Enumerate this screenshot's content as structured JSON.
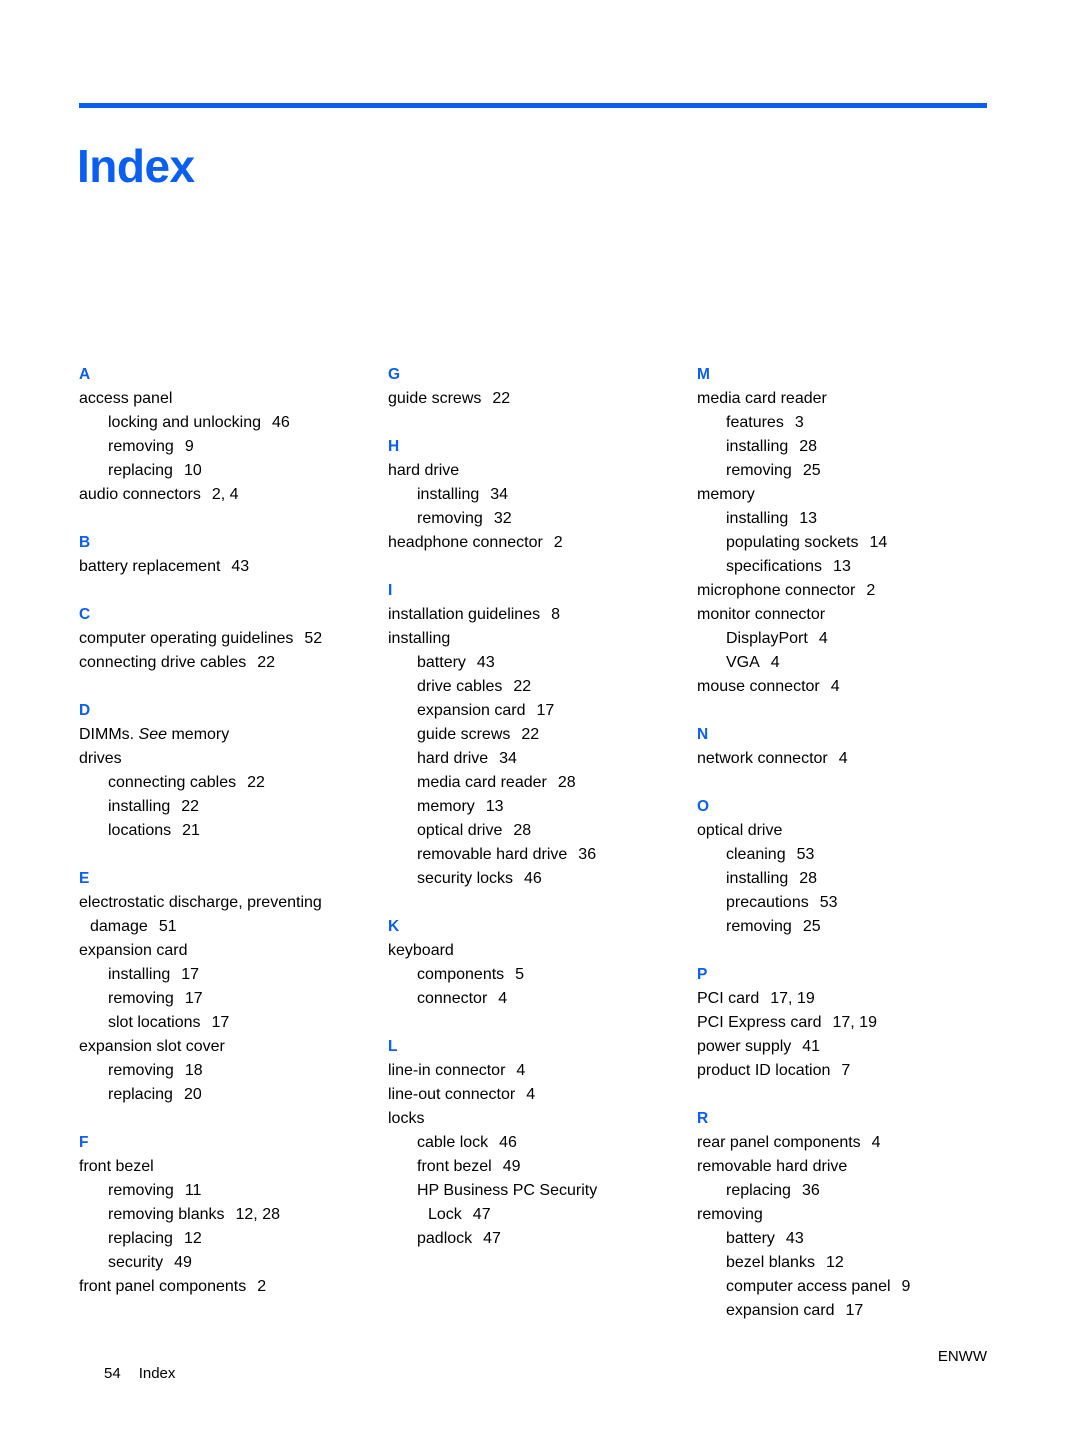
{
  "document": {
    "title": "Index",
    "accent_color": "#0a5ff0"
  },
  "footer": {
    "page_number": "54",
    "section_label": "Index",
    "right_label": "ENWW"
  },
  "columns": [
    {
      "groups": [
        {
          "letter": "A",
          "entries": [
            {
              "level": 1,
              "text": "access panel",
              "pages": ""
            },
            {
              "level": 2,
              "text": "locking and unlocking",
              "pages": "46"
            },
            {
              "level": 2,
              "text": "removing",
              "pages": "9"
            },
            {
              "level": 2,
              "text": "replacing",
              "pages": "10"
            },
            {
              "level": 1,
              "text": "audio connectors",
              "pages": "2,  4"
            }
          ]
        },
        {
          "letter": "B",
          "entries": [
            {
              "level": 1,
              "text": "battery replacement",
              "pages": "43"
            }
          ]
        },
        {
          "letter": "C",
          "entries": [
            {
              "level": 1,
              "text": "computer operating guidelines",
              "pages": "52"
            },
            {
              "level": 1,
              "text": "connecting drive cables",
              "pages": "22"
            }
          ]
        },
        {
          "letter": "D",
          "entries": [
            {
              "level": 1,
              "text": "DIMMs. ",
              "italic": "See",
              "text_after": " memory",
              "pages": ""
            },
            {
              "level": 1,
              "text": "drives",
              "pages": ""
            },
            {
              "level": 2,
              "text": "connecting cables",
              "pages": "22"
            },
            {
              "level": 2,
              "text": "installing",
              "pages": "22"
            },
            {
              "level": 2,
              "text": "locations",
              "pages": "21"
            }
          ]
        },
        {
          "letter": "E",
          "entries": [
            {
              "level": 1,
              "text": "electrostatic discharge, preventing",
              "pages": ""
            },
            {
              "level": "cont-1",
              "text": "damage",
              "pages": "51"
            },
            {
              "level": 1,
              "text": "expansion card",
              "pages": ""
            },
            {
              "level": 2,
              "text": "installing",
              "pages": "17"
            },
            {
              "level": 2,
              "text": "removing",
              "pages": "17"
            },
            {
              "level": 2,
              "text": "slot locations",
              "pages": "17"
            },
            {
              "level": 1,
              "text": "expansion slot cover",
              "pages": ""
            },
            {
              "level": 2,
              "text": "removing",
              "pages": "18"
            },
            {
              "level": 2,
              "text": "replacing",
              "pages": "20"
            }
          ]
        },
        {
          "letter": "F",
          "entries": [
            {
              "level": 1,
              "text": "front bezel",
              "pages": ""
            },
            {
              "level": 2,
              "text": "removing",
              "pages": "11"
            },
            {
              "level": 2,
              "text": "removing blanks",
              "pages": "12,  28"
            },
            {
              "level": 2,
              "text": "replacing",
              "pages": "12"
            },
            {
              "level": 2,
              "text": "security",
              "pages": "49"
            },
            {
              "level": 1,
              "text": "front panel components",
              "pages": "2"
            }
          ]
        }
      ]
    },
    {
      "groups": [
        {
          "letter": "G",
          "entries": [
            {
              "level": 1,
              "text": "guide screws",
              "pages": "22"
            }
          ]
        },
        {
          "letter": "H",
          "entries": [
            {
              "level": 1,
              "text": "hard drive",
              "pages": ""
            },
            {
              "level": 2,
              "text": "installing",
              "pages": "34"
            },
            {
              "level": 2,
              "text": "removing",
              "pages": "32"
            },
            {
              "level": 1,
              "text": "headphone connector",
              "pages": "2"
            }
          ]
        },
        {
          "letter": "I",
          "entries": [
            {
              "level": 1,
              "text": "installation guidelines",
              "pages": "8"
            },
            {
              "level": 1,
              "text": "installing",
              "pages": ""
            },
            {
              "level": 2,
              "text": "battery",
              "pages": "43"
            },
            {
              "level": 2,
              "text": "drive cables",
              "pages": "22"
            },
            {
              "level": 2,
              "text": "expansion card",
              "pages": "17"
            },
            {
              "level": 2,
              "text": "guide screws",
              "pages": "22"
            },
            {
              "level": 2,
              "text": "hard drive",
              "pages": "34"
            },
            {
              "level": 2,
              "text": "media card reader",
              "pages": "28"
            },
            {
              "level": 2,
              "text": "memory",
              "pages": "13"
            },
            {
              "level": 2,
              "text": "optical drive",
              "pages": "28"
            },
            {
              "level": 2,
              "text": "removable hard drive",
              "pages": "36"
            },
            {
              "level": 2,
              "text": "security locks",
              "pages": "46"
            }
          ]
        },
        {
          "letter": "K",
          "entries": [
            {
              "level": 1,
              "text": "keyboard",
              "pages": ""
            },
            {
              "level": 2,
              "text": "components",
              "pages": "5"
            },
            {
              "level": 2,
              "text": "connector",
              "pages": "4"
            }
          ]
        },
        {
          "letter": "L",
          "entries": [
            {
              "level": 1,
              "text": "line-in connector",
              "pages": "4"
            },
            {
              "level": 1,
              "text": "line-out connector",
              "pages": "4"
            },
            {
              "level": 1,
              "text": "locks",
              "pages": ""
            },
            {
              "level": 2,
              "text": "cable lock",
              "pages": "46"
            },
            {
              "level": 2,
              "text": "front bezel",
              "pages": "49"
            },
            {
              "level": 2,
              "text": "HP Business PC Security",
              "pages": ""
            },
            {
              "level": "cont-2",
              "text": "Lock",
              "pages": "47"
            },
            {
              "level": 2,
              "text": "padlock",
              "pages": "47"
            }
          ]
        }
      ]
    },
    {
      "groups": [
        {
          "letter": "M",
          "entries": [
            {
              "level": 1,
              "text": "media card reader",
              "pages": ""
            },
            {
              "level": 2,
              "text": "features",
              "pages": "3"
            },
            {
              "level": 2,
              "text": "installing",
              "pages": "28"
            },
            {
              "level": 2,
              "text": "removing",
              "pages": "25"
            },
            {
              "level": 1,
              "text": "memory",
              "pages": ""
            },
            {
              "level": 2,
              "text": "installing",
              "pages": "13"
            },
            {
              "level": 2,
              "text": "populating sockets",
              "pages": "14"
            },
            {
              "level": 2,
              "text": "specifications",
              "pages": "13"
            },
            {
              "level": 1,
              "text": "microphone connector",
              "pages": "2"
            },
            {
              "level": 1,
              "text": "monitor connector",
              "pages": ""
            },
            {
              "level": 2,
              "text": "DisplayPort",
              "pages": "4"
            },
            {
              "level": 2,
              "text": "VGA",
              "pages": "4"
            },
            {
              "level": 1,
              "text": "mouse connector",
              "pages": "4"
            }
          ]
        },
        {
          "letter": "N",
          "entries": [
            {
              "level": 1,
              "text": "network connector",
              "pages": "4"
            }
          ]
        },
        {
          "letter": "O",
          "entries": [
            {
              "level": 1,
              "text": "optical drive",
              "pages": ""
            },
            {
              "level": 2,
              "text": "cleaning",
              "pages": "53"
            },
            {
              "level": 2,
              "text": "installing",
              "pages": "28"
            },
            {
              "level": 2,
              "text": "precautions",
              "pages": "53"
            },
            {
              "level": 2,
              "text": "removing",
              "pages": "25"
            }
          ]
        },
        {
          "letter": "P",
          "entries": [
            {
              "level": 1,
              "text": "PCI card",
              "pages": "17,  19"
            },
            {
              "level": 1,
              "text": "PCI Express card",
              "pages": "17,  19"
            },
            {
              "level": 1,
              "text": "power supply",
              "pages": "41"
            },
            {
              "level": 1,
              "text": "product ID location",
              "pages": "7"
            }
          ]
        },
        {
          "letter": "R",
          "entries": [
            {
              "level": 1,
              "text": "rear panel components",
              "pages": "4"
            },
            {
              "level": 1,
              "text": "removable hard drive",
              "pages": ""
            },
            {
              "level": 2,
              "text": "replacing",
              "pages": "36"
            },
            {
              "level": 1,
              "text": "removing",
              "pages": ""
            },
            {
              "level": 2,
              "text": "battery",
              "pages": "43"
            },
            {
              "level": 2,
              "text": "bezel blanks",
              "pages": "12"
            },
            {
              "level": 2,
              "text": "computer access panel",
              "pages": "9"
            },
            {
              "level": 2,
              "text": "expansion card",
              "pages": "17"
            }
          ]
        }
      ]
    }
  ]
}
